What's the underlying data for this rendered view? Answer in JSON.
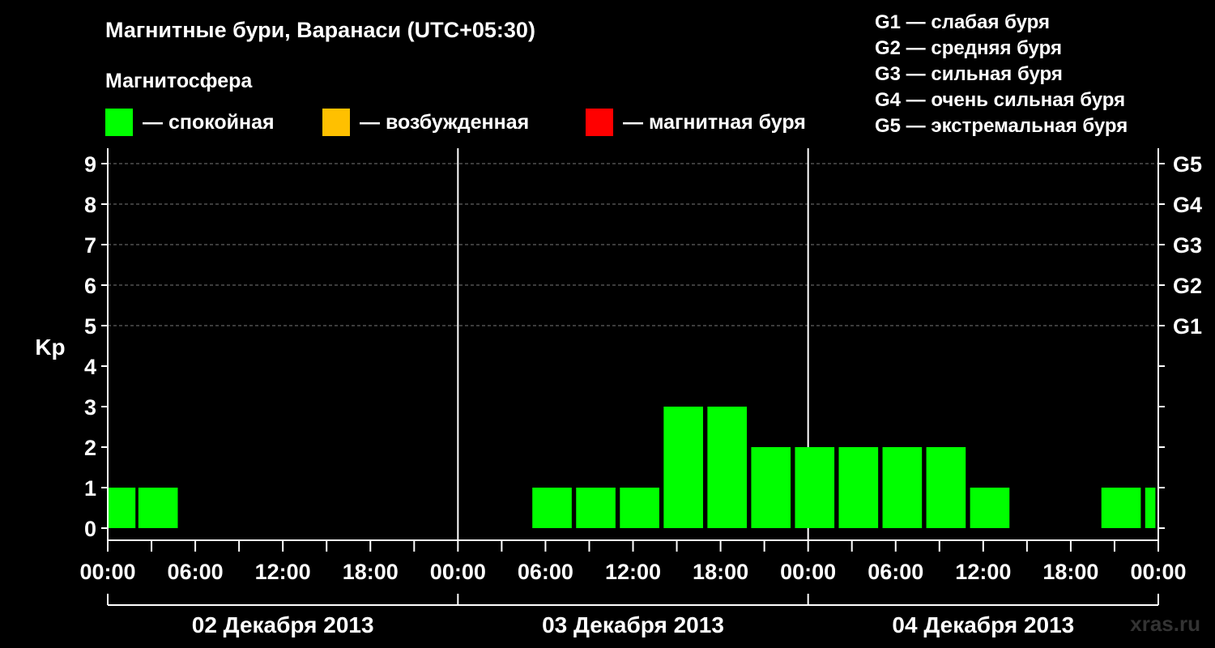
{
  "title": "Магнитные бури, Варанаси (UTC+05:30)",
  "subtitle": "Магнитосфера",
  "legend": [
    {
      "label": "— спокойная",
      "color": "#00ff00"
    },
    {
      "label": "— возбужденная",
      "color": "#ffc000"
    },
    {
      "label": "— магнитная буря",
      "color": "#ff0000"
    }
  ],
  "g_legend": [
    "G1 — слабая буря",
    "G2 — средняя буря",
    "G3 — сильная буря",
    "G4 — очень сильная буря",
    "G5 — экстремальная буря"
  ],
  "watermark": "xras.ru",
  "chart_data": {
    "type": "bar",
    "ylabel": "Kp",
    "ylim": [
      0,
      9
    ],
    "yticks": [
      "0",
      "1",
      "2",
      "3",
      "4",
      "5",
      "6",
      "7",
      "8",
      "9"
    ],
    "right_ticks": [
      {
        "kp": 5,
        "label": "G1"
      },
      {
        "kp": 6,
        "label": "G2"
      },
      {
        "kp": 7,
        "label": "G3"
      },
      {
        "kp": 8,
        "label": "G4"
      },
      {
        "kp": 9,
        "label": "G5"
      }
    ],
    "xlim_hours": [
      0,
      72
    ],
    "xtick_labels": [
      "00:00",
      "06:00",
      "12:00",
      "18:00",
      "00:00",
      "06:00",
      "12:00",
      "18:00",
      "00:00",
      "06:00",
      "12:00",
      "18:00",
      "00:00"
    ],
    "days": [
      "02 Декабря 2013",
      "03 Декабря 2013",
      "04 Декабря 2013"
    ],
    "grid": "dashed at Kp 5–9",
    "bars": [
      {
        "start": 0,
        "end": 1.9,
        "kp": 1,
        "level": "спокойная"
      },
      {
        "start": 2.1,
        "end": 4.8,
        "kp": 1,
        "level": "спокойная"
      },
      {
        "start": 29.1,
        "end": 31.8,
        "kp": 1,
        "level": "спокойная"
      },
      {
        "start": 32.1,
        "end": 34.8,
        "kp": 1,
        "level": "спокойная"
      },
      {
        "start": 35.1,
        "end": 37.8,
        "kp": 1,
        "level": "спокойная"
      },
      {
        "start": 38.1,
        "end": 40.8,
        "kp": 3,
        "level": "спокойная"
      },
      {
        "start": 41.1,
        "end": 43.8,
        "kp": 3,
        "level": "спокойная"
      },
      {
        "start": 44.1,
        "end": 46.8,
        "kp": 2,
        "level": "спокойная"
      },
      {
        "start": 47.1,
        "end": 49.8,
        "kp": 2,
        "level": "спокойная"
      },
      {
        "start": 50.1,
        "end": 52.8,
        "kp": 2,
        "level": "спокойная"
      },
      {
        "start": 53.1,
        "end": 55.8,
        "kp": 2,
        "level": "спокойная"
      },
      {
        "start": 56.1,
        "end": 58.8,
        "kp": 2,
        "level": "спокойная"
      },
      {
        "start": 59.1,
        "end": 61.8,
        "kp": 1,
        "level": "спокойная"
      },
      {
        "start": 68.1,
        "end": 70.8,
        "kp": 1,
        "level": "спокойная"
      },
      {
        "start": 71.1,
        "end": 71.8,
        "kp": 1,
        "level": "спокойная"
      }
    ]
  }
}
